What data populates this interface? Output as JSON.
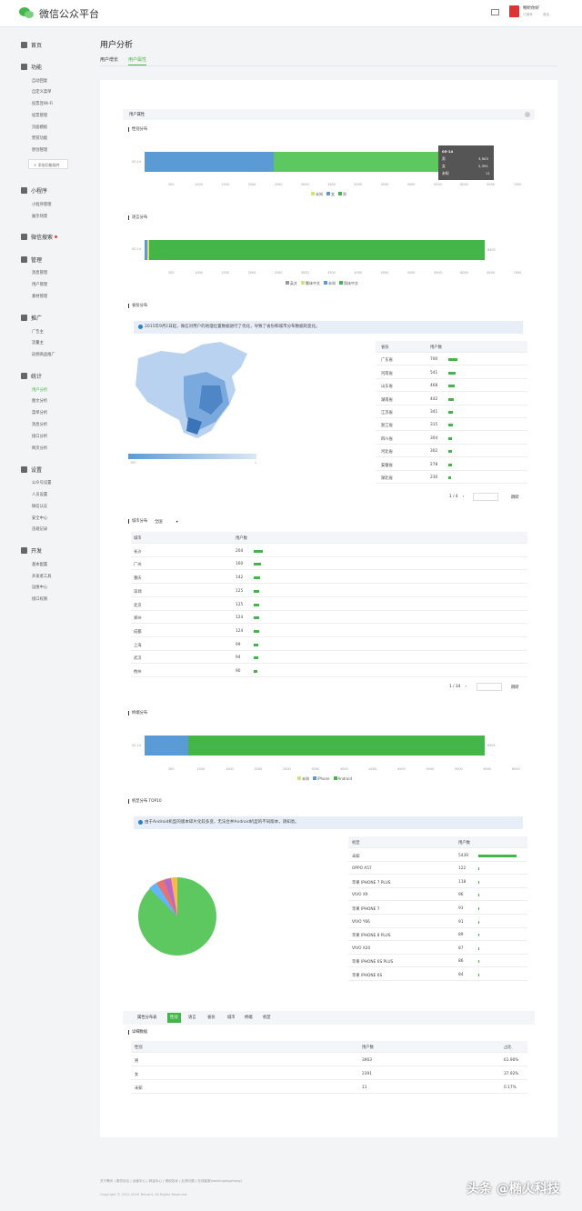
{
  "header": {
    "brand": "微信公众平台",
    "account_name": "畅听你好",
    "account_type": "订阅号",
    "logout": "退出"
  },
  "sidebar": {
    "home": "首页",
    "feature": {
      "title": "功能",
      "items": [
        "自动回复",
        "自定义菜单",
        "投票连Wi-Fi",
        "投票管理",
        "页面模板",
        "赞赏功能",
        "原创管理"
      ],
      "add": "+ 添加功能插件"
    },
    "miniprogram": {
      "title": "小程序",
      "items": [
        "小程序管理",
        "展示场景"
      ]
    },
    "search": {
      "title": "微信搜索"
    },
    "manage": {
      "title": "管理",
      "items": [
        "消息管理",
        "用户管理",
        "素材管理"
      ]
    },
    "promote": {
      "title": "推广",
      "items": [
        "广告主",
        "流量主",
        "返佣商品推广"
      ]
    },
    "stats": {
      "title": "统计",
      "items": [
        "用户分析",
        "图文分析",
        "菜单分析",
        "消息分析",
        "接口分析",
        "网页分析"
      ]
    },
    "settings": {
      "title": "设置",
      "items": [
        "公众号设置",
        "人员设置",
        "微信认证",
        "安全中心",
        "违规记录"
      ]
    },
    "dev": {
      "title": "开发",
      "items": [
        "基本配置",
        "开发者工具",
        "运维中心",
        "接口权限"
      ]
    }
  },
  "page": {
    "title": "用户分析",
    "tabs": [
      "用户增长",
      "用户属性"
    ],
    "panel_title": "用户属性"
  },
  "gender": {
    "heading": "性别分布",
    "row_label": "05-14",
    "axis": [
      "500",
      "1000",
      "1500",
      "2000",
      "2500",
      "3000",
      "3500",
      "4000",
      "4500",
      "5000",
      "5500",
      "6000",
      "6500",
      "7000"
    ],
    "legend": [
      "未知",
      "女",
      "男"
    ],
    "tooltip": {
      "title": "05-14",
      "rows": [
        {
          "k": "男",
          "v": "3,903"
        },
        {
          "k": "女",
          "v": "2,391"
        },
        {
          "k": "未知",
          "v": "11"
        }
      ]
    },
    "values": {
      "unknown": 11,
      "female": 2391,
      "male": 3903
    }
  },
  "language": {
    "heading": "语言分布",
    "row_label": "05-14",
    "end_label": "6305",
    "legend": [
      "英文",
      "繁体中文",
      "未知",
      "简体中文"
    ]
  },
  "province": {
    "heading": "省份分布",
    "notice": "2015年9月1日起，微信对用户的地理位置数据进行了优化，导致了省份和城市分布数据的变化。",
    "legend_max": "700",
    "legend_min": "1",
    "cols": [
      "省份",
      "用户数"
    ],
    "rows": [
      {
        "name": "广东省",
        "v": "700"
      },
      {
        "name": "河南省",
        "v": "541"
      },
      {
        "name": "山东省",
        "v": "468"
      },
      {
        "name": "湖南省",
        "v": "442"
      },
      {
        "name": "江苏省",
        "v": "341"
      },
      {
        "name": "浙江省",
        "v": "315"
      },
      {
        "name": "四川省",
        "v": "304"
      },
      {
        "name": "河北省",
        "v": "302"
      },
      {
        "name": "安徽省",
        "v": "278"
      },
      {
        "name": "湖北省",
        "v": "230"
      }
    ],
    "pager": "1 / 4",
    "jump": "跳转"
  },
  "city": {
    "heading": "城市分布",
    "filter": "全国",
    "cols": [
      "城市",
      "用户数"
    ],
    "rows": [
      {
        "name": "长沙",
        "v": "204"
      },
      {
        "name": "广州",
        "v": "160"
      },
      {
        "name": "重庆",
        "v": "142"
      },
      {
        "name": "深圳",
        "v": "125"
      },
      {
        "name": "北京",
        "v": "125"
      },
      {
        "name": "郑州",
        "v": "124"
      },
      {
        "name": "成都",
        "v": "124"
      },
      {
        "name": "上海",
        "v": "99"
      },
      {
        "name": "武汉",
        "v": "94"
      },
      {
        "name": "杭州",
        "v": "90"
      }
    ],
    "pager": "1 / 34",
    "jump": "跳转"
  },
  "terminal": {
    "heading": "终端分布",
    "row_label": "05-14",
    "end_label": "6305",
    "axis": [
      "500",
      "1000",
      "1500",
      "2000",
      "2500",
      "3000",
      "3500",
      "4000",
      "4500",
      "5000",
      "5500",
      "6000",
      "6500"
    ],
    "legend": [
      "未知",
      "iPhone",
      "Android"
    ]
  },
  "model": {
    "heading": "机型分布 TOP10",
    "notice": "由于Android机型的版本碎片化较多变，无法合并Android机型的不同版本，请知悉。",
    "cols": [
      "机型",
      "用户数"
    ],
    "rows": [
      {
        "name": "未知",
        "v": "5439"
      },
      {
        "name": "OPPO A57",
        "v": "122"
      },
      {
        "name": "苹果 IPHONE 7 PLUS",
        "v": "118"
      },
      {
        "name": "VIVO X9",
        "v": "96"
      },
      {
        "name": "苹果 IPHONE 7",
        "v": "93"
      },
      {
        "name": "VIVO Y66",
        "v": "91"
      },
      {
        "name": "苹果 IPHONE 8 PLUS",
        "v": "89"
      },
      {
        "name": "VIVO X20",
        "v": "87"
      },
      {
        "name": "苹果 IPHONE 6S PLUS",
        "v": "86"
      },
      {
        "name": "苹果 IPHONE 6S",
        "v": "84"
      }
    ]
  },
  "detail": {
    "tabs": [
      "属性分布表",
      "性别",
      "语言",
      "省份",
      "城市",
      "终端",
      "机型"
    ],
    "heading": "详细数据",
    "cols": [
      "性别",
      "用户数",
      "占比"
    ],
    "rows": [
      {
        "k": "男",
        "v": "3903",
        "p": "61.90%"
      },
      {
        "k": "女",
        "v": "2391",
        "p": "37.92%"
      },
      {
        "k": "未知",
        "v": "11",
        "p": "0.17%"
      }
    ]
  },
  "footer": {
    "links": "关于腾讯 | 服务协议 | 运营中心 | 辟谣中心 | 侵权投诉 | 反馈问题 | 在线客服(weixingongzhong)",
    "copyright": "Copyright © 2012-2018 Tencent. All Rights Reserved."
  },
  "watermark": "头条 @椭火科技",
  "colors": {
    "green": "#44b549",
    "blue": "#5b9bd5",
    "lightgreen": "#91cc75"
  }
}
